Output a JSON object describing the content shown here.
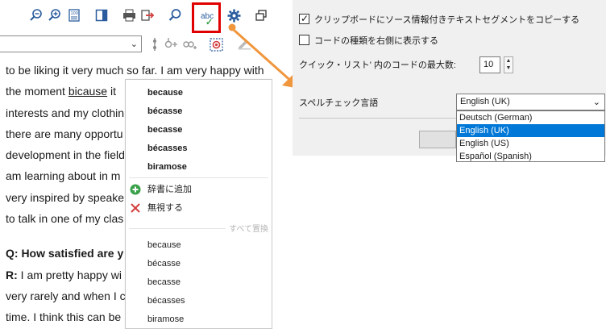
{
  "toolbar": {
    "icons": [
      "zoom-out-icon",
      "zoom-in-icon",
      "fit-page-icon",
      "panel-toggle-icon",
      "print-icon",
      "export-icon",
      "search-icon",
      "spellcheck-icon",
      "settings-icon",
      "window-restore-icon"
    ],
    "spellcheck_label": "abc",
    "spellcheck_active": true,
    "highlight_color": "#e00000"
  },
  "document": {
    "lines": [
      "to be liking it very much so far. I am very happy with",
      "the moment ",
      "interests and my clothin",
      "there are many opportu",
      "development in the field",
      "am learning about in m",
      "very inspired by speake",
      "to talk in one of my clas"
    ],
    "misspelled_word": "bicause",
    "after_misspelled": " it",
    "question": "Q: How satisfied are y",
    "answer_prefix": "R:",
    "answer_lines": [
      " I am pretty happy wi",
      "very rarely and when I c",
      "time. I think this can be"
    ]
  },
  "context_menu": {
    "suggestions": [
      "because",
      "bécasse",
      "becasse",
      "bécasses",
      "biramose"
    ],
    "add_to_dictionary": "辞書に追加",
    "ignore": "無視する",
    "replace_all": "すべて置換",
    "replace_suggestions": [
      "because",
      "bécasse",
      "becasse",
      "bécasses",
      "biramose"
    ]
  },
  "settings": {
    "copy_source_info": "クリップボードにソース情報付きテキストセグメントをコピーする",
    "copy_source_info_checked": true,
    "show_code_type": "コードの種類を右側に表示する",
    "show_code_type_checked": false,
    "quick_list_label": "クイック・リスト' 内のコードの最大数:",
    "quick_list_value": "10",
    "spellcheck_language_label": "スペルチェック言語",
    "spellcheck_language_value": "English (UK)",
    "language_options": [
      "Deutsch (German)",
      "English (UK)",
      "English (US)",
      "Español (Spanish)"
    ],
    "selected_language_index": 1,
    "arrow_color": "#f0963c"
  }
}
